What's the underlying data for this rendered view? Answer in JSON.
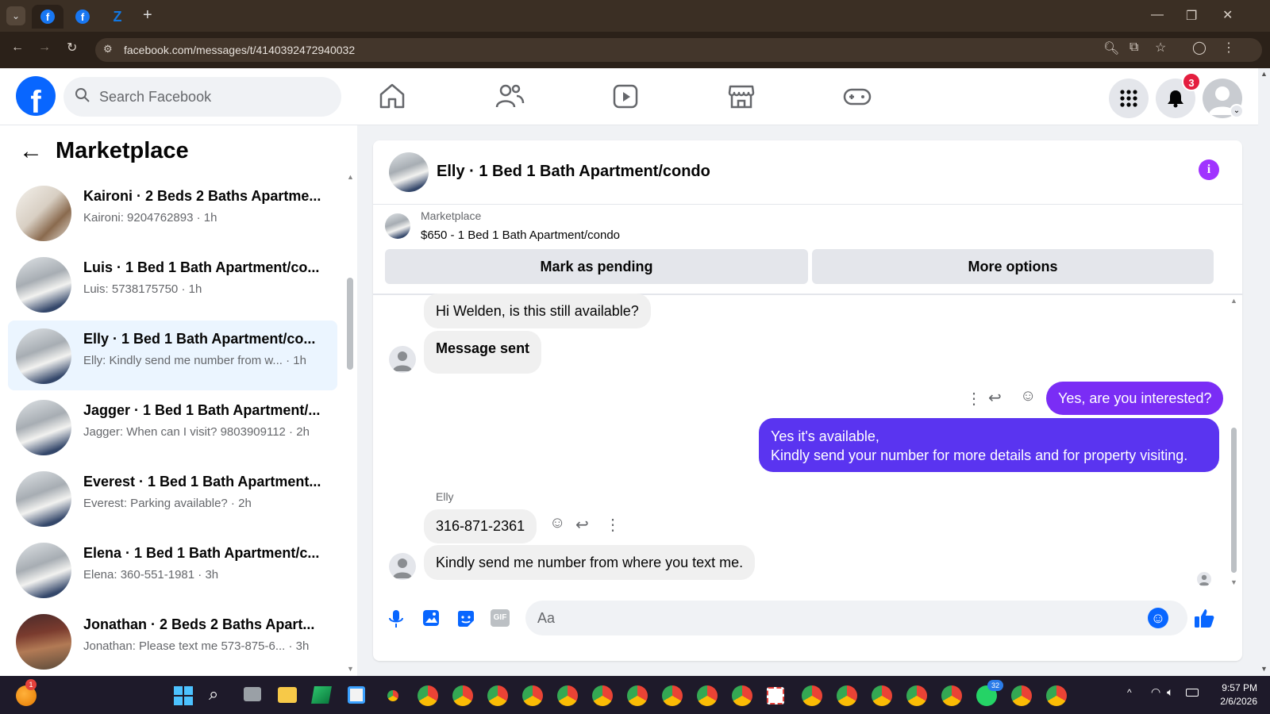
{
  "browser": {
    "url": "facebook.com/messages/t/4140392472940032",
    "new_tab": "+"
  },
  "header": {
    "search_placeholder": "Search Facebook",
    "notification_count": "3"
  },
  "sidebar": {
    "title": "Marketplace",
    "conversations": [
      {
        "title": "Kaironi · 2 Beds 2 Baths Apartme...",
        "subtitle": "Kaironi: 9204762893 · 1h"
      },
      {
        "title": "Luis · 1 Bed 1 Bath Apartment/co...",
        "subtitle": "Luis: 5738175750 · 1h"
      },
      {
        "title": "Elly · 1 Bed 1 Bath Apartment/co...",
        "subtitle": "Elly: Kindly send me number from w... · 1h"
      },
      {
        "title": "Jagger · 1 Bed 1 Bath Apartment/...",
        "subtitle": "Jagger: When can I visit? 9803909112 · 2h"
      },
      {
        "title": "Everest · 1 Bed 1 Bath Apartment...",
        "subtitle": "Everest: Parking available? · 2h"
      },
      {
        "title": "Elena · 1 Bed 1 Bath Apartment/c...",
        "subtitle": "Elena: 360-551-1981 · 3h"
      },
      {
        "title": "Jonathan · 2 Beds 2 Baths Apart...",
        "subtitle": "Jonathan: Please text me 573-875-6... · 3h"
      }
    ]
  },
  "chat": {
    "title": "Elly · 1 Bed 1 Bath Apartment/condo",
    "listing_source": "Marketplace",
    "listing_title": "$650 - 1 Bed 1 Bath Apartment/condo",
    "mark_pending": "Mark as pending",
    "more_options": "More options",
    "messages": {
      "m1": "Hi Welden, is this still available?",
      "m2": "Message sent",
      "m3": "Yes, are you interested?",
      "m4a": "Yes it's available,",
      "m4b": "Kindly send your number for more details and for property visiting.",
      "sender": "Elly",
      "m5": "316-871-2361",
      "m6": "Kindly send me number from where you text me."
    },
    "composer_placeholder": "Aa"
  },
  "taskbar": {
    "time": "9:57 PM",
    "date": "2/6/2026",
    "whatsapp_badge": "32",
    "weather_badge": "1"
  },
  "colors": {
    "fb_blue": "#0866ff",
    "outgoing_bubble": "#7a2df5",
    "active_conv": "#ebf5ff"
  }
}
